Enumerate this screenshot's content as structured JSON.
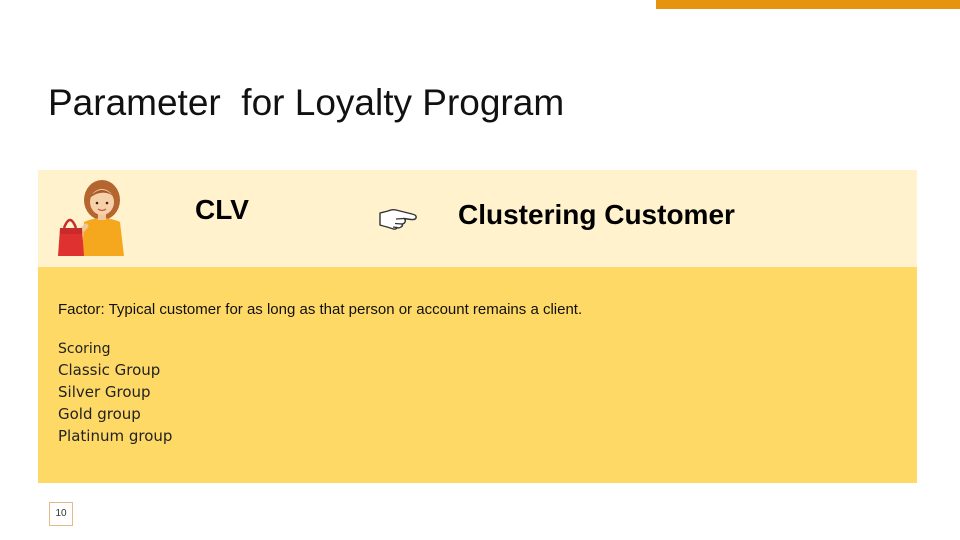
{
  "slide": {
    "title": "Parameter  for Loyalty Program",
    "page_number": "10",
    "accent_color": "#e69410"
  },
  "header": {
    "left_label": "CLV",
    "right_label": "Clustering Customer",
    "avatar_icon": "shopping-woman-icon",
    "arrow_icon": "pointing-hand-icon",
    "band_color": "#fff2cc"
  },
  "content": {
    "factor_text": "Factor: Typical customer for as long as that person or account remains a client.",
    "scoring_heading": "Scoring",
    "scoring_items": [
      "Classic Group",
      "Silver Group",
      "Gold group",
      "Platinum group"
    ],
    "band_color": "#ffd966"
  }
}
